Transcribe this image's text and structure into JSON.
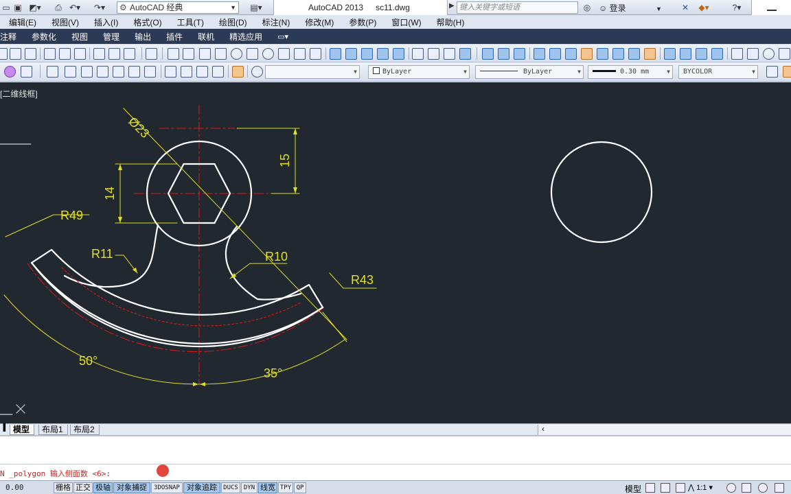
{
  "titlebar": {
    "workspace": "AutoCAD 经典",
    "app": "AutoCAD 2013",
    "file": "sc11.dwg",
    "search_placeholder": "键入关键字或短语",
    "login": "登录",
    "help": "?"
  },
  "menubar": [
    "编辑(E)",
    "视图(V)",
    "插入(I)",
    "格式(O)",
    "工具(T)",
    "绘图(D)",
    "标注(N)",
    "修改(M)",
    "参数(P)",
    "窗口(W)",
    "帮助(H)"
  ],
  "ribbon_tabs": [
    "注释",
    "参数化",
    "视图",
    "管理",
    "输出",
    "插件",
    "联机",
    "精选应用"
  ],
  "properties": {
    "color": "ByLayer",
    "linetype": "ByLayer",
    "lineweight": "0.30 mm",
    "plotstyle": "BYCOLOR"
  },
  "viewport": {
    "label": "[二维线框]"
  },
  "drawing": {
    "dims": {
      "diameter": "Ø23",
      "r49": "R49",
      "r11": "R11",
      "r10": "R10",
      "r43": "R43",
      "d14": "14",
      "d15": "15",
      "a50": "50°",
      "a35": "35°"
    }
  },
  "layout_tabs": [
    "模型",
    "布局1",
    "布局2"
  ],
  "command": {
    "line": "N _polygon 输入侧面数 <6>:"
  },
  "status": {
    "coords": "0.00",
    "buttons": [
      {
        "label": "栅格",
        "on": false
      },
      {
        "label": "正交",
        "on": false
      },
      {
        "label": "极轴",
        "on": true
      },
      {
        "label": "对象捕捉",
        "on": true
      },
      {
        "label": "3DOSNAP",
        "on": false
      },
      {
        "label": "对象追踪",
        "on": true
      },
      {
        "label": "DUCS",
        "on": false
      },
      {
        "label": "DYN",
        "on": false
      },
      {
        "label": "线宽",
        "on": true
      },
      {
        "label": "TPY",
        "on": false
      },
      {
        "label": "QP",
        "on": false
      }
    ],
    "model": "模型",
    "scale": "1:1"
  },
  "colors": {
    "canvas": "#212830",
    "geometry": "#ffffff",
    "dimension": "#e0e020",
    "centerline": "#e01818"
  }
}
